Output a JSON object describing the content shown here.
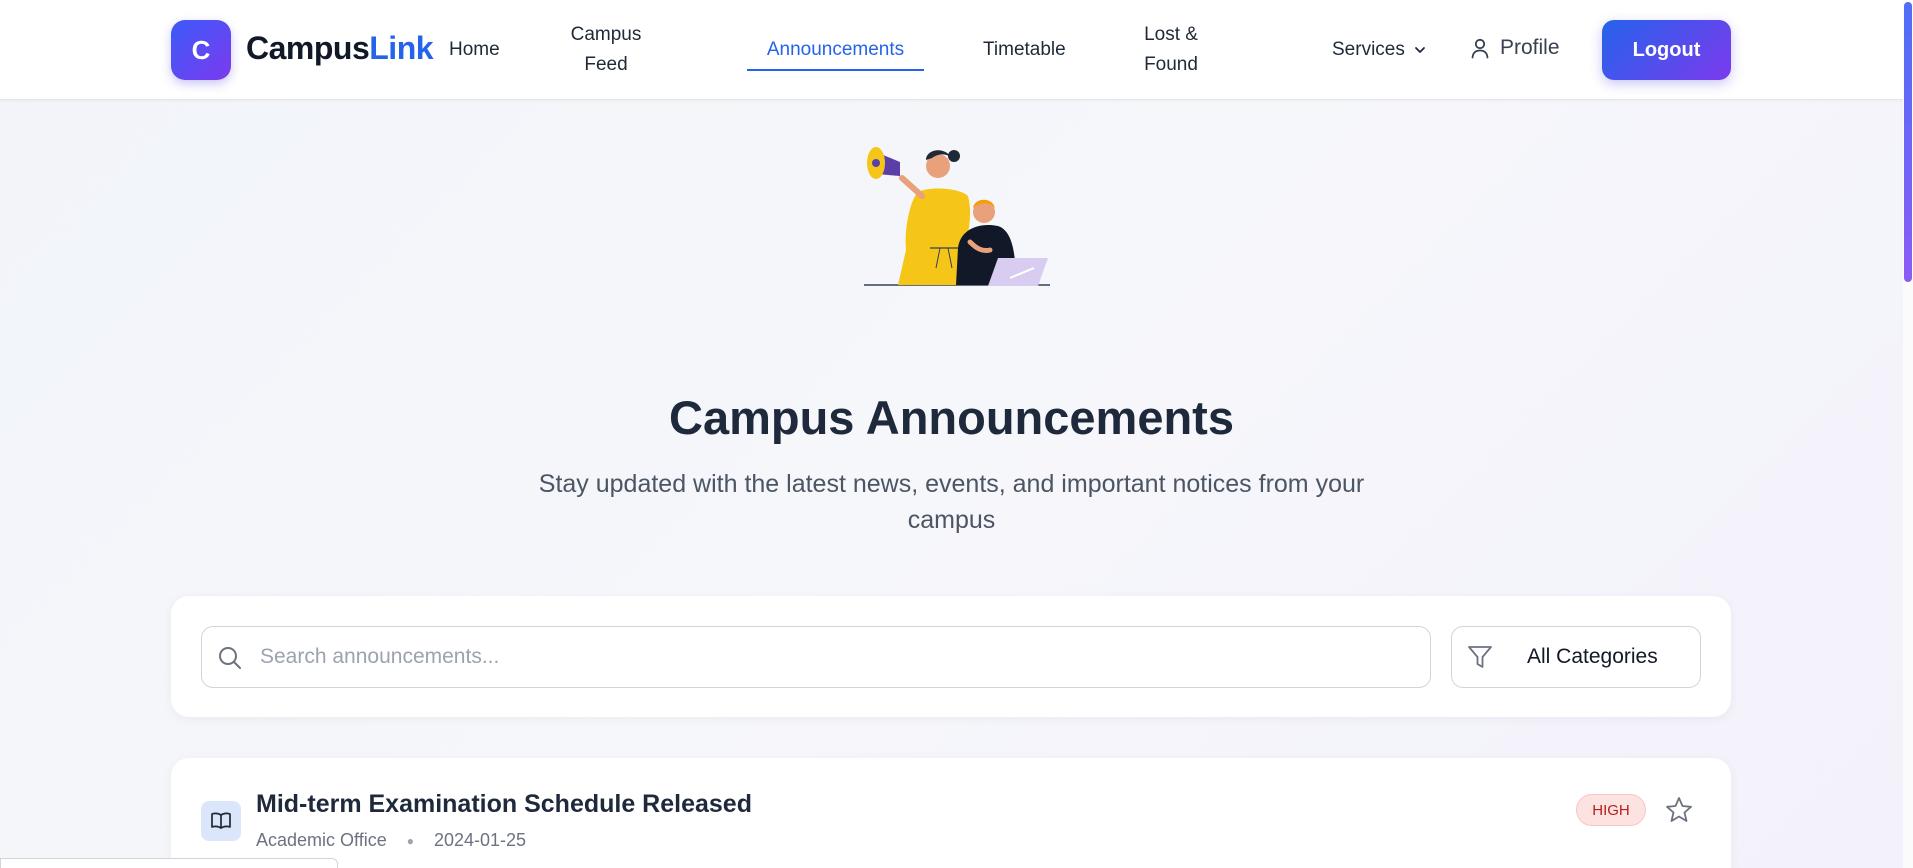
{
  "brand": {
    "badge_letter": "C",
    "name_primary": "Campus",
    "name_accent": "Link"
  },
  "nav": {
    "home": "Home",
    "campus_feed": "Campus Feed",
    "announcements": "Announcements",
    "timetable": "Timetable",
    "lost_found": "Lost & Found",
    "services": "Services",
    "profile": "Profile",
    "logout": "Logout"
  },
  "hero": {
    "title": "Campus Announcements",
    "subtitle": "Stay updated with the latest news, events, and important notices from your campus"
  },
  "search": {
    "placeholder": "Search announcements...",
    "value": "",
    "category_selected": "All Categories"
  },
  "announcements": [
    {
      "title": "Mid-term Examination Schedule Released",
      "source": "Academic Office",
      "date": "2024-01-25",
      "priority": "HIGH",
      "icon": "book-icon"
    }
  ],
  "colors": {
    "accent": "#2563eb",
    "gradient_start": "#3b5bfa",
    "gradient_end": "#7c3aed",
    "priority_high_bg": "#fde2e2",
    "priority_high_text": "#b91c1c"
  }
}
